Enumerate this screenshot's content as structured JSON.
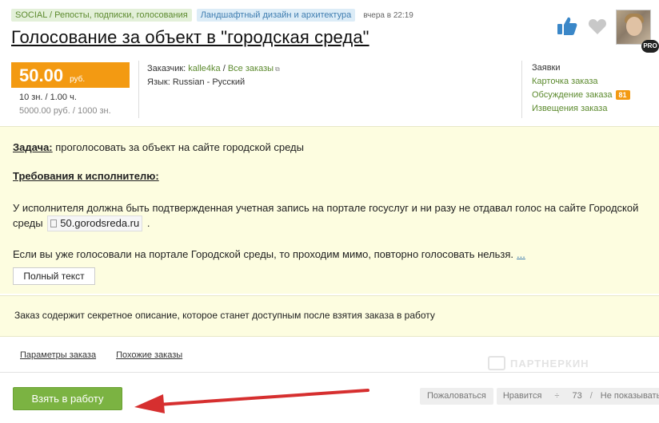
{
  "header": {
    "category_tag": "SOCIAL / Репосты, подписки, голосования",
    "subcategory_tag": "Ландшафтный дизайн и архитектура",
    "time": "вчера в 22:19",
    "title": "Голосование за объект в \"городская среда\"",
    "pro_badge": "PRO",
    "icons": {
      "like": "thumbs-up-icon",
      "favorite": "heart-icon"
    }
  },
  "price": {
    "value": "50.00",
    "currency": "руб.",
    "quantity": "10 зн.  /  1.00 ч.",
    "total": "5000.00 руб.  /  1000 зн."
  },
  "customer": {
    "label": "Заказчик:",
    "name": "kalle4ka",
    "separator": "/",
    "all_orders": "Все заказы",
    "language": "Язык: Russian - Русский"
  },
  "side_links": {
    "heading": "Заявки",
    "card": "Карточка заказа",
    "discussion": "Обсуждение заказа",
    "discussion_count": "81",
    "notifications": "Извещения заказа"
  },
  "description": {
    "task_label": "Задача:",
    "task_text": " проголосовать за объект на сайте городской среды",
    "requirements_label": "Требования к исполнителю:",
    "requirements_text_1": "У исполнителя должна быть подтвержденная учетная запись на портале госуслуг и ни разу не отдавал голос на сайте Городской",
    "requirements_text_2": "среды",
    "site": "50.gorodsreda.ru",
    "after_site": " .",
    "note": "Если вы уже голосовали на портале Городской среды, то проходим мимо, повторно голосовать нельзя.",
    "more": "...",
    "full_text_button": "Полный текст"
  },
  "secret_notice": "Заказ содержит секретное описание, которое станет доступным после взятия заказа в работу",
  "bottom_links": {
    "params": "Параметры заказа",
    "similar": "Похожие заказы"
  },
  "watermark": "ПАРТНЕРКИН",
  "actions": {
    "take": "Взять в работу",
    "complain": "Пожаловаться",
    "likes": "Нравится",
    "likes_sep": "÷",
    "likes_count": "73",
    "hide": "Не показывать",
    "slash": "/"
  },
  "colors": {
    "accent_orange": "#f39a12",
    "accent_green": "#7bb342",
    "like_blue": "#3a87c8",
    "highlight_yellow": "#fdfde0",
    "arrow_red": "#d62f2f"
  }
}
